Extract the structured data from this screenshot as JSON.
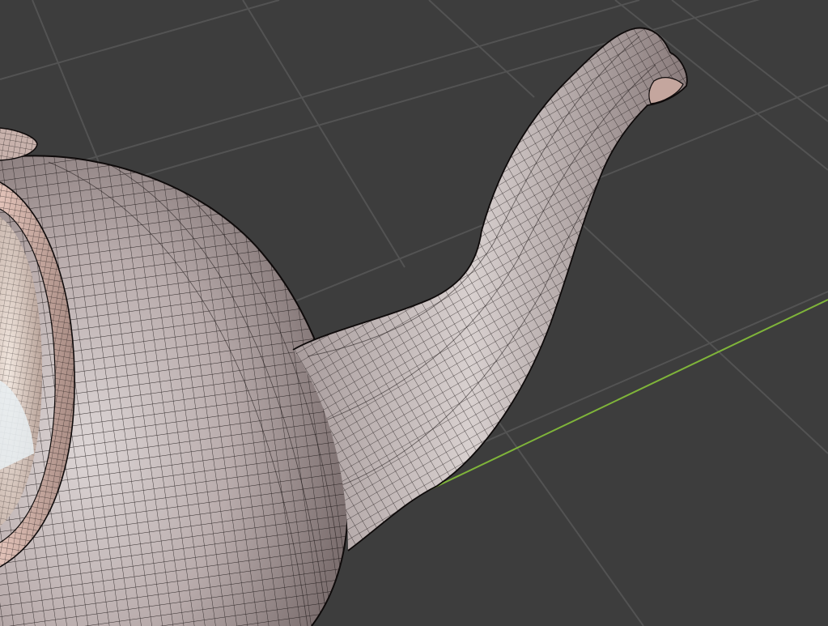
{
  "viewport": {
    "background_color": "#3d3d3d",
    "grid_color": "#555555",
    "y_axis_color": "#7fb43a",
    "object": "teapot",
    "shading": "solid",
    "overlay": "wireframe",
    "wire_color": "#141414",
    "surface_light": "#d9d2d2",
    "surface_mid": "#b7aaaa",
    "surface_dark": "#7a6d6d",
    "rim_color": "#c9a79e"
  }
}
